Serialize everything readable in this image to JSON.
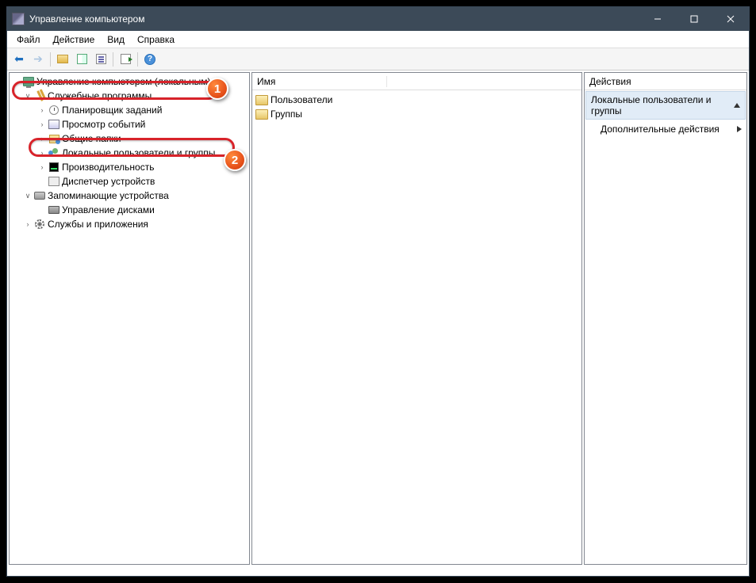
{
  "titlebar": {
    "title": "Управление компьютером"
  },
  "menu": {
    "file": "Файл",
    "action": "Действие",
    "view": "Вид",
    "help": "Справка"
  },
  "tree": {
    "root": "Управление компьютером (локальным)",
    "utilities": "Служебные программы",
    "scheduler": "Планировщик заданий",
    "events": "Просмотр событий",
    "shared": "Общие папки",
    "users": "Локальные пользователи и группы",
    "perf": "Производительность",
    "devmgr": "Диспетчер устройств",
    "storage": "Запоминающие устройства",
    "diskmgr": "Управление дисками",
    "services": "Службы и приложения"
  },
  "listHeader": {
    "name": "Имя"
  },
  "listItems": {
    "users": "Пользователи",
    "groups": "Группы"
  },
  "actions": {
    "header": "Действия",
    "group": "Локальные пользователи и группы",
    "more": "Дополнительные действия"
  },
  "callouts": {
    "c1": "1",
    "c2": "2"
  }
}
